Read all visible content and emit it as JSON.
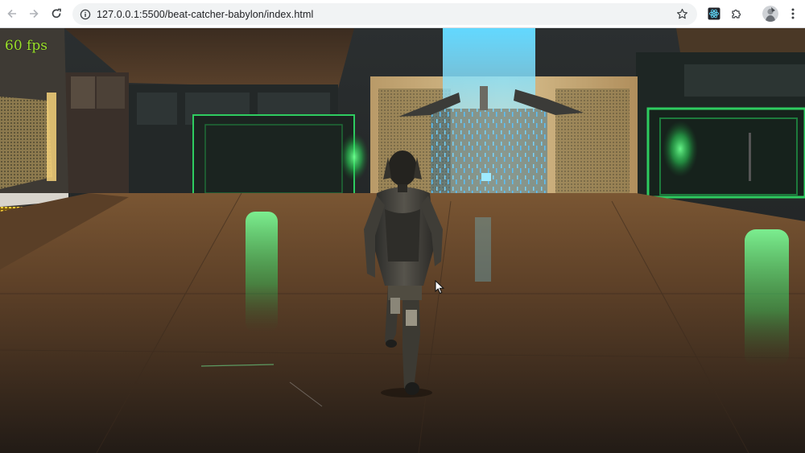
{
  "browser": {
    "url": "127.0.0.1:5500/beat-catcher-babylon/index.html",
    "icons": {
      "back": "arrow-left-icon",
      "forward": "arrow-right-icon",
      "reload": "reload-icon",
      "site_info": "site-info-icon",
      "bookmark": "star-icon",
      "extension_1": "react-devtools-icon",
      "extension_2": "puzzle-icon",
      "profile": "avatar",
      "menu": "kebab-menu-icon"
    }
  },
  "game": {
    "fps_label": "60 fps",
    "colors": {
      "fps": "#9be22d",
      "floor": "#6b4a2a",
      "neon_green": "#2cff6a",
      "portal_blue": "#5fd6ff",
      "amber_panel": "#ffd43b"
    }
  }
}
